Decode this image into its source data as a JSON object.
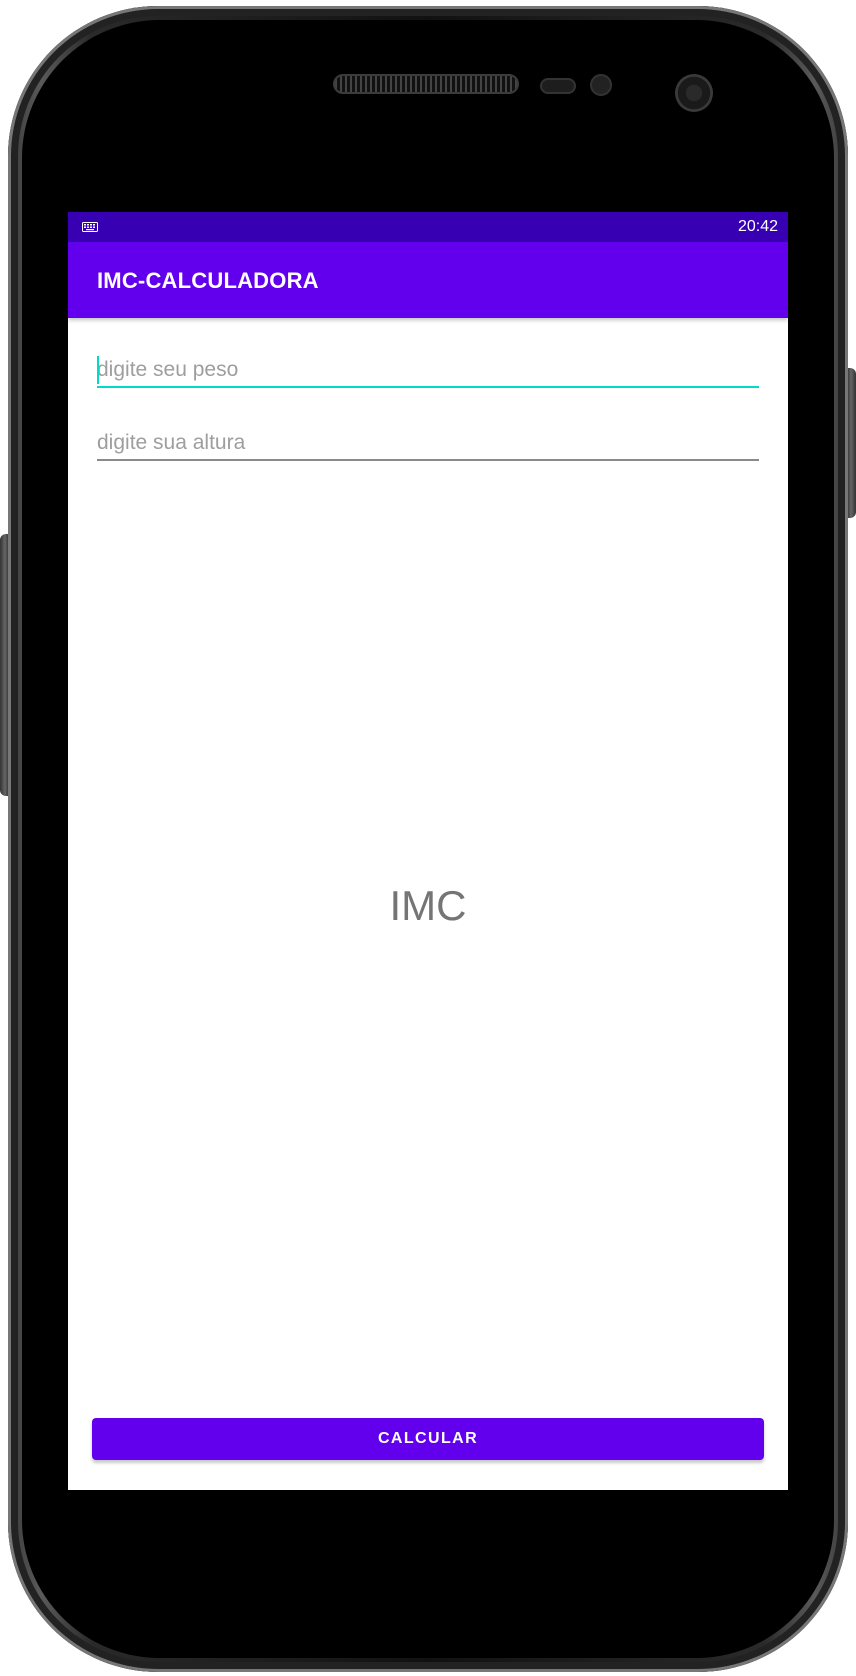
{
  "status_bar": {
    "time": "20:42",
    "left_icon": "keyboard-icon",
    "color": "#3700b3"
  },
  "app_bar": {
    "title": "IMC-CALCULADORA",
    "color": "#6200ee"
  },
  "form": {
    "peso": {
      "value": "",
      "placeholder": "digite seu peso",
      "focused": true
    },
    "altura": {
      "value": "",
      "placeholder": "digite sua altura",
      "focused": false
    }
  },
  "result": {
    "text": "IMC"
  },
  "actions": {
    "calculate_label": "CALCULAR"
  },
  "colors": {
    "accent": "#03dac5",
    "primary": "#6200ee",
    "primary_dark": "#3700b3"
  }
}
